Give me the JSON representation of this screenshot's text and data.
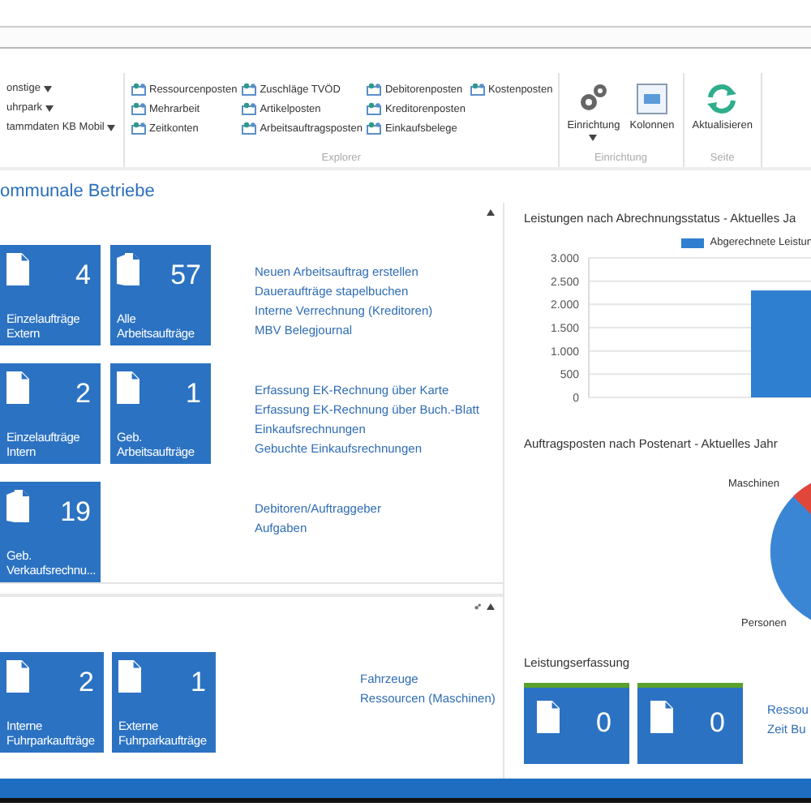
{
  "ribbon": {
    "groups": [
      {
        "kind": "menu",
        "items": [
          {
            "label": "onstige",
            "dropdown": true
          },
          {
            "label": "uhrpark",
            "dropdown": true
          },
          {
            "label": "tammdaten KB Mobil",
            "dropdown": true
          }
        ]
      },
      {
        "kind": "explorer",
        "label": "Explorer",
        "columns": [
          [
            "Ressourcenposten",
            "Mehrarbeit",
            "Zeitkonten"
          ],
          [
            "Zuschläge TVÖD",
            "Artikelposten",
            "Arbeitsauftragsposten"
          ],
          [
            "Debitorenposten",
            "Kreditorenposten",
            "Einkaufsbelege"
          ],
          [
            "Kostenposten"
          ]
        ]
      },
      {
        "kind": "large",
        "label": "Einrichtung",
        "buttons": [
          {
            "label": "Einrichtung",
            "dropdown": true
          },
          {
            "label": "Kolonnen",
            "dropdown": false
          }
        ]
      },
      {
        "kind": "large",
        "label": "Seite",
        "buttons": [
          {
            "label": "Aktualisieren",
            "dropdown": false
          }
        ]
      }
    ]
  },
  "title": "ommunale Betriebe",
  "parts": [
    {
      "settings": false,
      "collapsible": true,
      "rows": [
        {
          "tiles": [
            {
              "count": "4",
              "label": [
                "Einzelaufträge",
                "Extern"
              ],
              "kind": "single"
            },
            {
              "count": "57",
              "label": [
                "Alle",
                "Arbeitsaufträge"
              ],
              "kind": "stack"
            }
          ],
          "links": [
            "Neuen Arbeitsauftrag erstellen",
            "Daueraufträge stapelbuchen",
            "Interne Verrechnung (Kreditoren)",
            "MBV Belegjournal"
          ]
        },
        {
          "tiles": [
            {
              "count": "2",
              "label": [
                "Einzelaufträge",
                "Intern"
              ],
              "kind": "single"
            },
            {
              "count": "1",
              "label": [
                "Geb.",
                "Arbeitsaufträge"
              ],
              "kind": "single"
            }
          ],
          "links": [
            "Erfassung EK-Rechnung über Karte",
            "Erfassung EK-Rechnung über Buch.-Blatt",
            "Einkaufsrechnungen",
            "Gebuchte Einkaufsrechnungen"
          ]
        },
        {
          "tiles": [
            {
              "count": "19",
              "label": [
                "Geb.",
                "Verkaufsrechnu..."
              ],
              "kind": "stack"
            }
          ],
          "links": [
            "Debitoren/Auftraggeber",
            "Aufgaben"
          ]
        }
      ]
    },
    {
      "settings": true,
      "collapsible": true,
      "rows": [
        {
          "tiles": [
            {
              "count": "2",
              "label": [
                "Interne",
                "Fuhrparkaufträge"
              ],
              "kind": "single"
            },
            {
              "count": "1",
              "label": [
                "Externe",
                "Fuhrparkaufträge"
              ],
              "kind": "single"
            }
          ],
          "links": [
            "Fahrzeuge",
            "Ressourcen (Maschinen)"
          ]
        }
      ]
    }
  ],
  "right": [
    {
      "kind": "bar_chart",
      "title": "Leistungen nach Abrechnungsstatus - Aktuelles Ja",
      "chart_data": {
        "type": "bar",
        "grid": true,
        "series": [
          {
            "name": "Abgerechnete Leistun",
            "color": "#2f7fd0",
            "values": [
              null,
              2300
            ]
          }
        ],
        "ylim": [
          0,
          3000
        ],
        "yticks": [
          {
            "value": 0,
            "label": "0"
          },
          {
            "value": 500,
            "label": "500"
          },
          {
            "value": 1000,
            "label": "1.000"
          },
          {
            "value": 1500,
            "label": "1.500"
          },
          {
            "value": 2000,
            "label": "2.000"
          },
          {
            "value": 2500,
            "label": "2.500"
          },
          {
            "value": 3000,
            "label": "3.000"
          }
        ]
      }
    },
    {
      "kind": "pie_chart",
      "title": "Auftragsposten nach Postenart - Aktuelles Jahr",
      "labels": [
        "Maschinen",
        "Personen"
      ]
    },
    {
      "kind": "tiles",
      "title": "Leistungserfassung",
      "tiles": [
        {
          "count": "0"
        },
        {
          "count": "0"
        }
      ],
      "links": [
        "Ressou",
        "Zeit Bu"
      ]
    }
  ]
}
